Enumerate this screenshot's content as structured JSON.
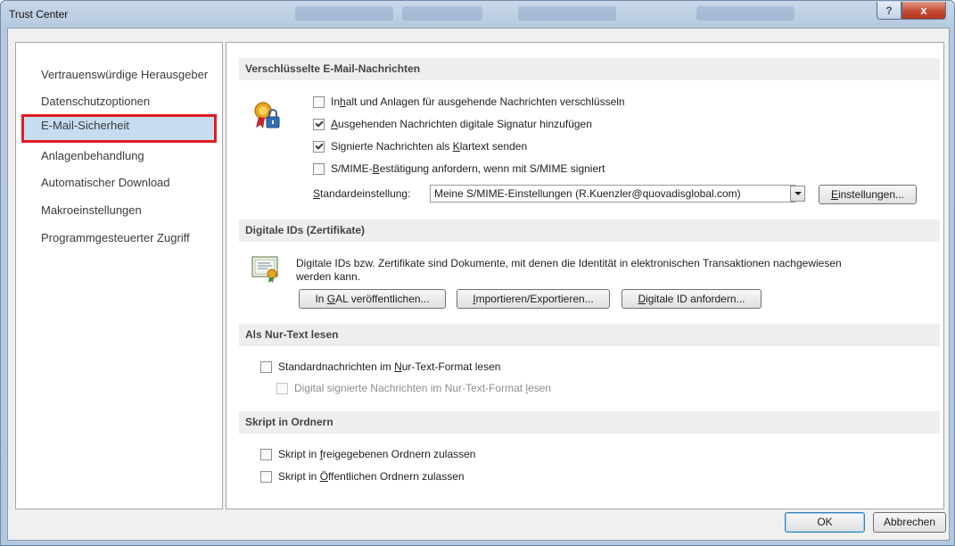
{
  "window": {
    "title": "Trust Center",
    "help_label": "?",
    "close_label": "x"
  },
  "sidebar": {
    "items": [
      {
        "label": "Vertrauenswürdige Herausgeber"
      },
      {
        "label": "Datenschutzoptionen"
      },
      {
        "label": "E-Mail-Sicherheit"
      },
      {
        "label": "Anlagenbehandlung"
      },
      {
        "label": "Automatischer Download"
      },
      {
        "label": "Makroeinstellungen"
      },
      {
        "label": "Programmgesteuerter Zugriff"
      }
    ],
    "selected_index": 2
  },
  "encrypted": {
    "heading": "Verschlüsselte E-Mail-Nachrichten",
    "icon": "certificate-lock-icon",
    "options": [
      {
        "pre": "In",
        "key": "h",
        "post": "alt und Anlagen für ausgehende Nachrichten verschlüsseln",
        "checked": false
      },
      {
        "pre": "",
        "key": "A",
        "post": "usgehenden Nachrichten digitale Signatur hinzufügen",
        "checked": true
      },
      {
        "pre": "Signierte Nachrichten als ",
        "key": "K",
        "post": "lartext senden",
        "checked": true
      },
      {
        "pre": "S/MIME-",
        "key": "B",
        "post": "estätigung anfordern, wenn mit S/MIME signiert",
        "checked": false
      }
    ],
    "default_label_key": "S",
    "default_label_rest": "tandardeinstellung:",
    "default_value": "Meine S/MIME-Einstellungen (R.Kuenzler@quovadisglobal.com)",
    "settings_key": "E",
    "settings_rest": "instellungen..."
  },
  "digital_ids": {
    "heading": "Digitale IDs (Zertifikate)",
    "icon": "certificate-icon",
    "description_line1": "Digitale IDs bzw. Zertifikate sind Dokumente, mit denen die Identität in elektronischen Transaktionen nachgewiesen",
    "description_line2": "werden kann.",
    "publish_pre": "In ",
    "publish_key": "G",
    "publish_post": "AL veröffentlichen...",
    "import_key": "I",
    "import_rest": "mportieren/Exportieren...",
    "request_key": "D",
    "request_rest": "igitale ID anfordern..."
  },
  "plain_text": {
    "heading": "Als Nur-Text lesen",
    "standard_pre": "Standardnachrichten im ",
    "standard_key": "N",
    "standard_post": "ur-Text-Format lesen",
    "standard_checked": false,
    "signed_pre": "Digital signierte Nachrichten im Nur-Text-Format ",
    "signed_key": "l",
    "signed_post": "esen",
    "signed_checked": false
  },
  "script": {
    "heading": "Skript in Ordnern",
    "shared_pre": "Skript in ",
    "shared_key": "f",
    "shared_post": "reigegebenen Ordnern zulassen",
    "shared_checked": false,
    "public_pre": "Skript in ",
    "public_key": "Ö",
    "public_post": "ffentlichen Ordnern zulassen",
    "public_checked": false
  },
  "footer": {
    "ok_label": "OK",
    "cancel_label": "Abbrechen"
  },
  "colors": {
    "selection_outline": "#e21b23",
    "selection_fill": "#c6ddf1"
  }
}
